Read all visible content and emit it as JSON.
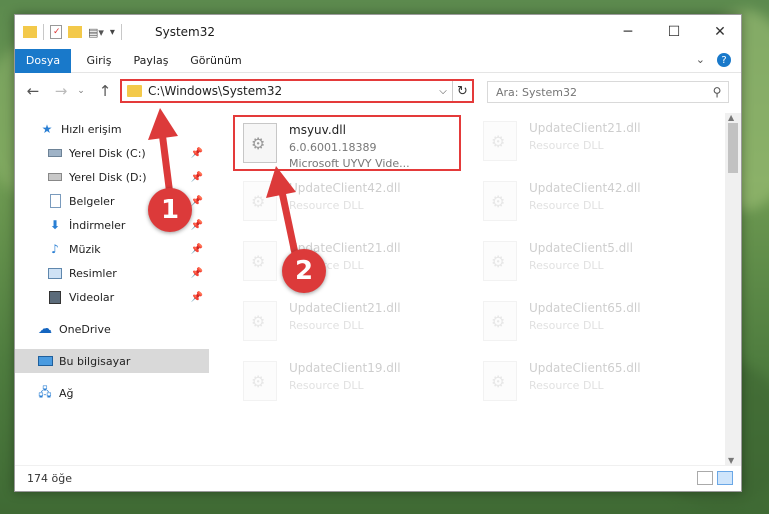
{
  "window": {
    "title": "System32"
  },
  "ribbon": {
    "tabs": [
      "Dosya",
      "Giriş",
      "Paylaş",
      "Görünüm"
    ]
  },
  "address": {
    "path": "C:\\Windows\\System32"
  },
  "search": {
    "placeholder": "Ara: System32"
  },
  "sidebar": {
    "items": [
      {
        "label": "Hızlı erişim",
        "icon": "star-icon"
      },
      {
        "label": "Yerel Disk (C:)",
        "icon": "drive-icon"
      },
      {
        "label": "Yerel Disk (D:)",
        "icon": "drive-icon"
      },
      {
        "label": "Belgeler",
        "icon": "documents-icon"
      },
      {
        "label": "İndirmeler",
        "icon": "download-icon"
      },
      {
        "label": "Müzik",
        "icon": "music-icon"
      },
      {
        "label": "Resimler",
        "icon": "pictures-icon"
      },
      {
        "label": "Videolar",
        "icon": "video-icon"
      },
      {
        "label": "OneDrive",
        "icon": "cloud-icon"
      },
      {
        "label": "Bu bilgisayar",
        "icon": "computer-icon"
      },
      {
        "label": "Ağ",
        "icon": "network-icon"
      }
    ]
  },
  "files": {
    "selected": {
      "name": "msyuv.dll",
      "version": "6.0.6001.18389",
      "description": "Microsoft UYVY Vide..."
    },
    "others": [
      {
        "name": "UpdateClient21.dll",
        "type": "Resource DLL"
      },
      {
        "name": "UpdateClient42.dll",
        "type": "Resource DLL"
      },
      {
        "name": "UpdateClient42.dll",
        "type": "Resource DLL"
      },
      {
        "name": "UpdateClient21.dll",
        "type": "Resource DLL"
      },
      {
        "name": "UpdateClient5.dll",
        "type": "Resource DLL"
      },
      {
        "name": "UpdateClient21.dll",
        "type": "Resource DLL"
      },
      {
        "name": "UpdateClient65.dll",
        "type": "Resource DLL"
      },
      {
        "name": "UpdateClient19.dll",
        "type": "Resource DLL"
      },
      {
        "name": "UpdateClient65.dll",
        "type": "Resource DLL"
      }
    ]
  },
  "status": {
    "count": "174 öğe"
  },
  "markers": {
    "one": "1",
    "two": "2"
  },
  "colors": {
    "accent": "#1979ca",
    "annotation": "#dc3a3a"
  }
}
